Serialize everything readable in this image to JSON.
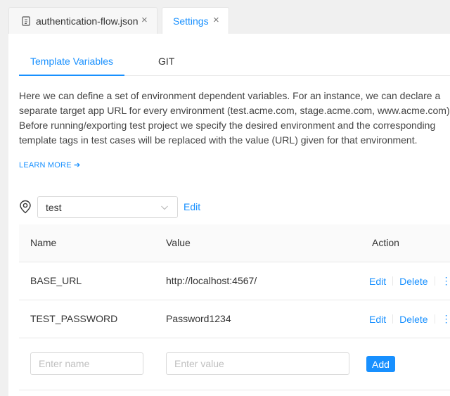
{
  "file_tabs": [
    {
      "label": "authentication-flow.json",
      "icon": "file-icon",
      "close": "×"
    },
    {
      "label": "Settings",
      "close": "×"
    }
  ],
  "settings": {
    "tabs": [
      "Template Variables",
      "GIT"
    ],
    "description": "Here we can define a set of environment dependent variables. For an instance, we can declare a separate target app URL for every environment (test.acme.com, stage.acme.com, www.acme.com). Before running/exporting test project we specify the desired environment and the corresponding template tags in test cases will be replaced with the value (URL) given for that environment.",
    "learn_more": "LEARN MORE ➔",
    "environment": {
      "selected": "test",
      "edit_label": "Edit"
    },
    "table": {
      "headers": {
        "name": "Name",
        "value": "Value",
        "action": "Action"
      },
      "rows": [
        {
          "name": "BASE_URL",
          "value": "http://localhost:4567/",
          "edit": "Edit",
          "delete": "Delete",
          "more": "⋮"
        },
        {
          "name": "TEST_PASSWORD",
          "value": "Password1234",
          "edit": "Edit",
          "delete": "Delete",
          "more": "⋮"
        }
      ],
      "new_row": {
        "name_placeholder": "Enter name",
        "value_placeholder": "Enter value",
        "add_label": "Add"
      }
    }
  },
  "colors": {
    "accent": "#1890ff",
    "panel": "#ffffff",
    "background": "#f0f0f0"
  }
}
